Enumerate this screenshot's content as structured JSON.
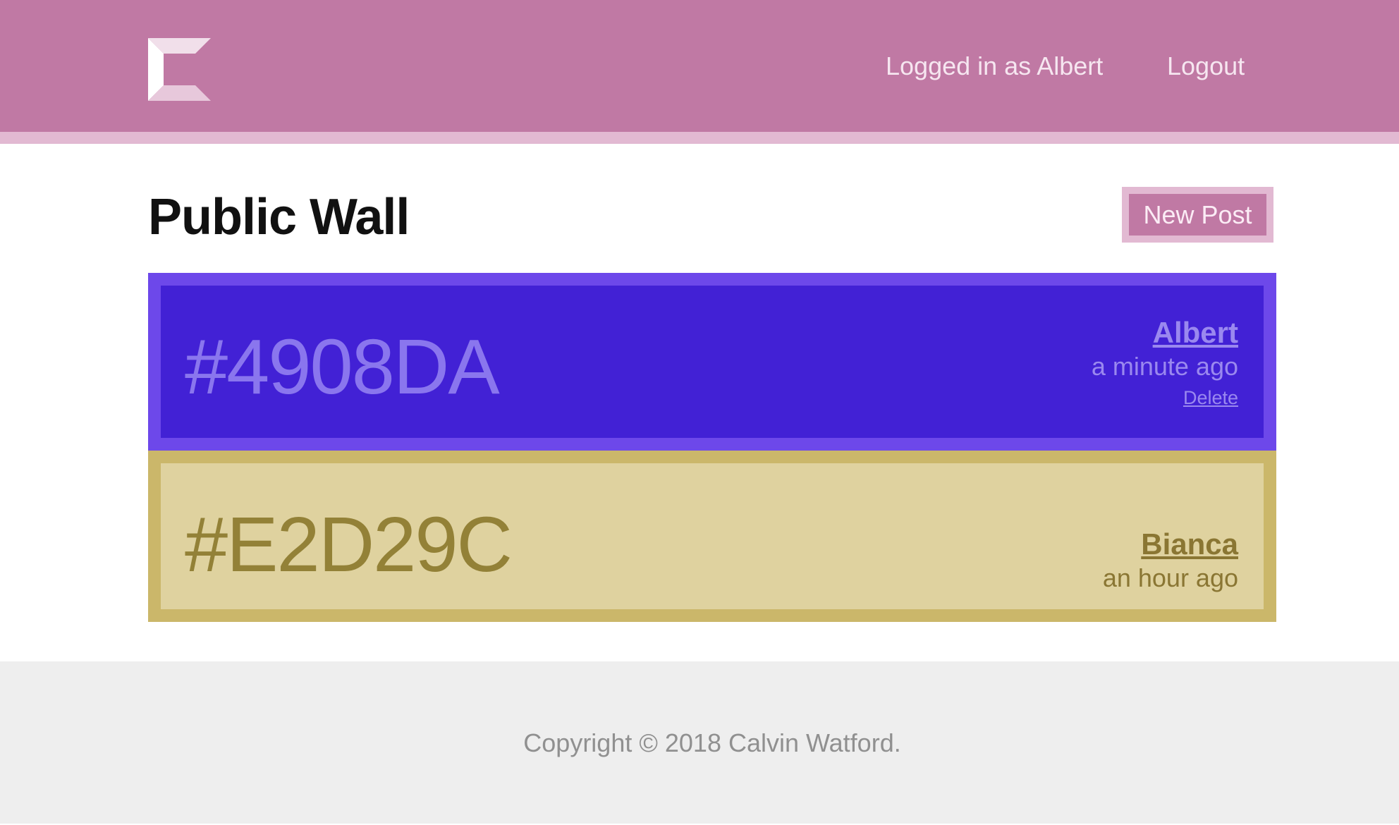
{
  "header": {
    "logo_icon": "c-logo-icon",
    "user_status": "Logged in as Albert",
    "logout_label": "Logout",
    "colors": {
      "bar": "#c079a4",
      "stripe": "#e2b9d2"
    }
  },
  "main": {
    "title": "Public Wall",
    "new_post_label": "New Post",
    "posts": [
      {
        "color_code": "#4908DA",
        "author": "Albert",
        "time": "a minute ago",
        "delete_label": "Delete",
        "colors": {
          "fill": "#4221d5",
          "border": "#6d48ea",
          "text": "#8a76ee"
        }
      },
      {
        "color_code": "#E2D29C",
        "author": "Bianca",
        "time": "an hour ago",
        "colors": {
          "fill": "#dfd29f",
          "border": "#cbb76a",
          "text": "#938137"
        }
      }
    ]
  },
  "footer": {
    "copyright": "Copyright © 2018 Calvin Watford."
  }
}
